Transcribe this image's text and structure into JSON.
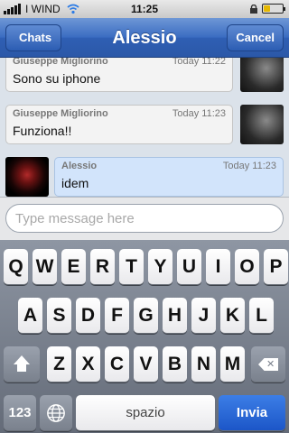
{
  "status_bar": {
    "carrier": "I WIND",
    "time": "11:25"
  },
  "nav": {
    "back_label": "Chats",
    "title": "Alessio",
    "cancel_label": "Cancel"
  },
  "messages": [
    {
      "sender": "Giuseppe Migliorino",
      "time": "Today 11:22",
      "text": "Sono su iphone",
      "from_me": false
    },
    {
      "sender": "Giuseppe Migliorino",
      "time": "Today 11:23",
      "text": "Funziona!!",
      "from_me": false
    },
    {
      "sender": "Alessio",
      "time": "Today 11:23",
      "text": "idem",
      "from_me": true
    }
  ],
  "composer": {
    "placeholder": "Type message here"
  },
  "keyboard": {
    "row1": [
      "Q",
      "W",
      "E",
      "R",
      "T",
      "Y",
      "U",
      "I",
      "O",
      "P"
    ],
    "row2": [
      "A",
      "S",
      "D",
      "F",
      "G",
      "H",
      "J",
      "K",
      "L"
    ],
    "row3": [
      "Z",
      "X",
      "C",
      "V",
      "B",
      "N",
      "M"
    ],
    "numbers_label": "123",
    "space_label": "spazio",
    "send_label": "Invia"
  }
}
